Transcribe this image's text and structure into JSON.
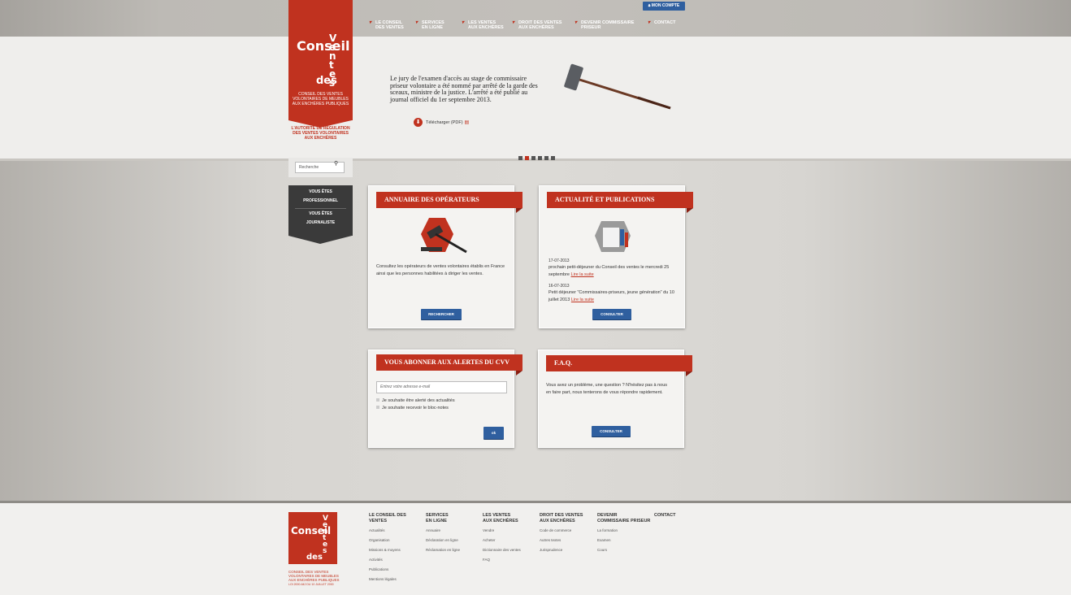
{
  "account_button": "MON COMPTE",
  "logo": {
    "word1": "Conseil",
    "word2": "des",
    "word3": "Ventes",
    "subtitle": "CONSEIL DES VENTES VOLONTAIRES DE MEUBLES AUX ENCHÈRES PUBLIQUES",
    "tagline": "L'AUTORITÉ DE RÉGULATION DES VENTES VOLONTAIRES AUX ENCHÈRES"
  },
  "nav": [
    {
      "l1": "LE CONSEIL",
      "l2": "DES VENTES"
    },
    {
      "l1": "SERVICES",
      "l2": "EN LIGNE"
    },
    {
      "l1": "LES VENTES",
      "l2": "AUX ENCHÈRES"
    },
    {
      "l1": "DROIT DES VENTES",
      "l2": "AUX ENCHÈRES"
    },
    {
      "l1": "DEVENIR COMMISSAIRE",
      "l2": "PRISEUR"
    },
    {
      "l1": "CONTACT",
      "l2": ""
    }
  ],
  "hero": {
    "text": "Le jury de l'examen d'accès au stage de commissaire priseur volontaire a été nommé par arrêté de la garde des sceaux, ministre de la justice. L'arrêté a été publié au journal officiel du 1er septembre 2013.",
    "download": "Télécharger (PDF)",
    "slides": 6,
    "active_slide": 2
  },
  "search": {
    "placeholder": "Recherche"
  },
  "who": {
    "pro": "VOUS ÊTES PROFESSIONNEL",
    "press": "VOUS ÊTES JOURNALISTE"
  },
  "cards": {
    "annuaire": {
      "title": "ANNUAIRE DES OPÉRATEURS",
      "text": "Consultez les opérateurs de ventes volontaires établis en France ainsi que les personnes habilitées à diriger les ventes.",
      "button": "RECHERCHER"
    },
    "actualite": {
      "title": "ACTUALITÉ ET PUBLICATIONS",
      "news": [
        {
          "date": "17-07-2013",
          "text": "prochain petit-déjeuner du Conseil des ventes le mercredi 25 septembre",
          "link": "Lire la suite"
        },
        {
          "date": "16-07-2013",
          "text": "Petit déjeuner \"Commissaires-priseurs, jeune génération\" du 10 juillet 2013",
          "link": "Lire la suite"
        }
      ],
      "button": "CONSULTER"
    },
    "alertes": {
      "title": "VOUS ABONNER AUX ALERTES DU CVV",
      "placeholder": "Entrez votre adresse e-mail",
      "opt1": "Je souhaite être alerté des actualités",
      "opt2": "Je souhaite recevoir le bloc-notes",
      "button": "ok"
    },
    "faq": {
      "title": "F.A.Q.",
      "text": "Vous avez un problème, une question ? N'hésitez pas à nous en faire part, nous tenterons de vous répondre rapidement.",
      "button": "CONSULTER"
    }
  },
  "footer": {
    "logo_small": "CONSEIL DES VENTES VOLONTAIRES DE MEUBLES AUX ENCHÈRES PUBLIQUES",
    "logo_law": "LOI 2000-642 DU 10 JUILLET 2000",
    "cols": [
      {
        "h1": "LE CONSEIL DES",
        "h2": "VENTES",
        "items": [
          "Actualités",
          "Organisation",
          "Missions & moyens",
          "Activités",
          "Publications",
          "Mentions légales"
        ]
      },
      {
        "h1": "SERVICES",
        "h2": "EN LIGNE",
        "items": [
          "Annuaire",
          "Déclaration en ligne",
          "Réclamation en ligne"
        ]
      },
      {
        "h1": "LES VENTES",
        "h2": "AUX ENCHÈRES",
        "items": [
          "Vendre",
          "Acheter",
          "Dictionnaire des ventes",
          "FAQ"
        ]
      },
      {
        "h1": "DROIT DES VENTES",
        "h2": "AUX ENCHÈRES",
        "items": [
          "Code de commerce",
          "Autres textes",
          "Jurisprudence"
        ]
      },
      {
        "h1": "DEVENIR",
        "h2": "COMMISSAIRE PRISEUR",
        "items": [
          "La formation",
          "Examen",
          "Cours"
        ]
      },
      {
        "h1": "CONTACT",
        "h2": "",
        "items": []
      }
    ]
  }
}
